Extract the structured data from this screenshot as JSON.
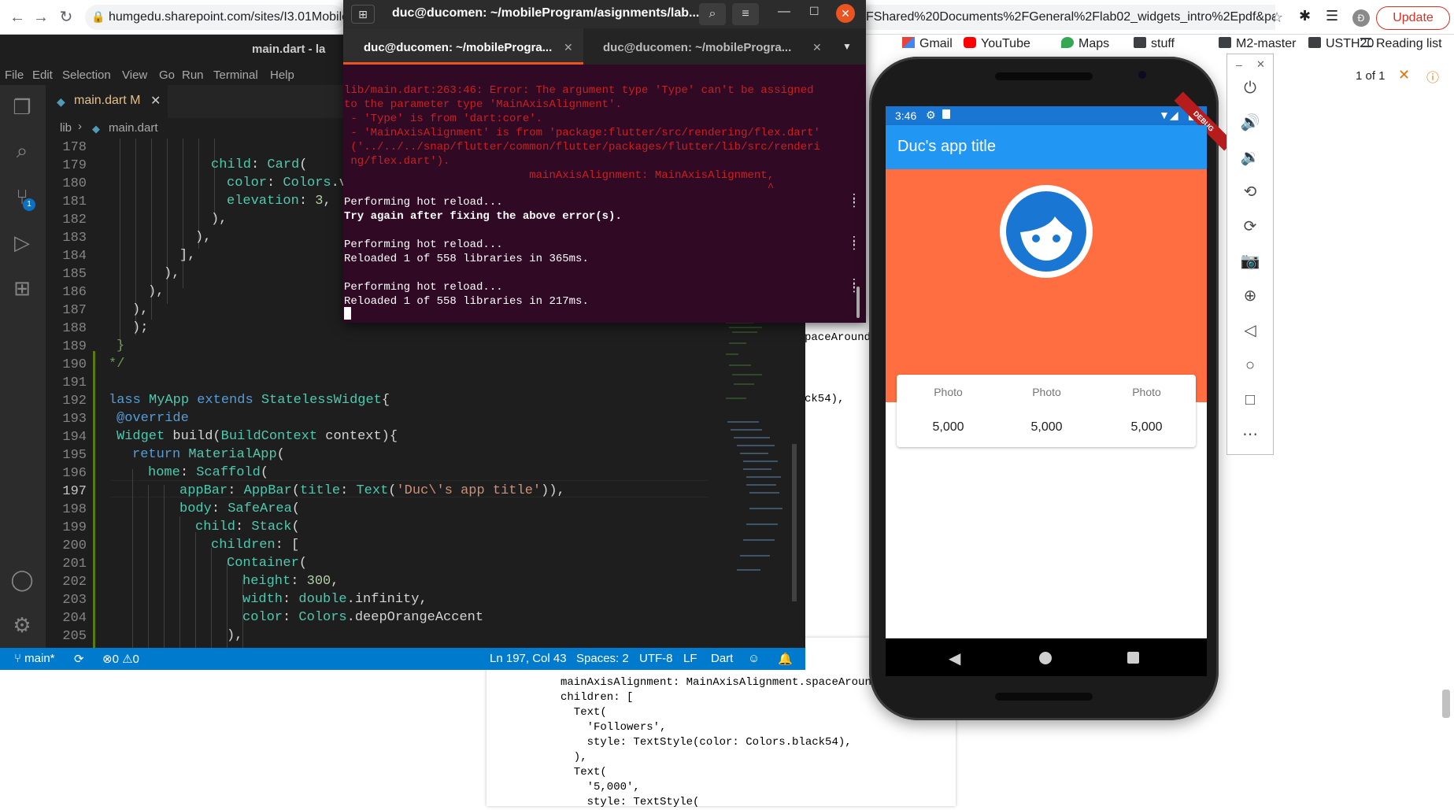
{
  "browser": {
    "url_left": "humgedu.sharepoint.com/sites/I3.01Mobilepro",
    "url_right": "FShared%20Documents%2FGeneral%2Flab02_widgets_intro%2Epdf&parent...",
    "avatar_letter": "Đ",
    "update_label": "Update",
    "bookmarks": [
      "Gmail",
      "YouTube",
      "Maps",
      "stuff",
      "M2-master",
      "USTH20"
    ],
    "reading_list": "Reading list",
    "pdf_pages": "1 of 1"
  },
  "pdf": {
    "right_snippets": [
      "paceAround",
      "ck54),"
    ],
    "code_lines": [
      "mainAxisAlignment: MainAxisAlignment.spaceAround,",
      "children: [",
      "  Text(",
      "    'Followers',",
      "    style: TextStyle(color: Colors.black54),",
      "  ),",
      "  Text(",
      "    '5,000',",
      "    style: TextStyle("
    ]
  },
  "vscode": {
    "window_title": "main.dart - la",
    "menus": [
      "File",
      "Edit",
      "Selection",
      "View",
      "Go",
      "Run",
      "Terminal",
      "Help"
    ],
    "tab_label": "main.dart",
    "tab_status": "M",
    "breadcrumb_folder": "lib",
    "breadcrumb_file": "main.dart",
    "scm_badge": "1",
    "line_numbers": [
      "178",
      "179",
      "180",
      "181",
      "182",
      "183",
      "184",
      "185",
      "186",
      "187",
      "188",
      "189",
      "190",
      "191",
      "192",
      "193",
      "194",
      "195",
      "196",
      "197",
      "198",
      "199",
      "200",
      "201",
      "202",
      "203",
      "204",
      "205"
    ],
    "status": {
      "branch": "main*",
      "problems": "0",
      "warnings": "0",
      "position": "Ln 197, Col 43",
      "spaces": "Spaces: 2",
      "encoding": "UTF-8",
      "eol": "LF",
      "language": "Dart"
    }
  },
  "terminal": {
    "title": "duc@ducomen: ~/mobileProgram/asignments/lab...",
    "tab1": "duc@ducomen: ~/mobileProgra...",
    "tab2": "duc@ducomen: ~/mobileProgra...",
    "error_lines": [
      "lib/main.dart:263:46: Error: The argument type 'Type' can't be assigned",
      "to the parameter type 'MainAxisAlignment'.",
      " - 'Type' is from 'dart:core'.",
      " - 'MainAxisAlignment' is from 'package:flutter/src/rendering/flex.dart'",
      " ('../../../snap/flutter/common/flutter/packages/flutter/lib/src/renderi",
      " ng/flex.dart').",
      "                            mainAxisAlignment: MainAxisAlignment,",
      "                                                                ^"
    ],
    "log": {
      "hot1": "Performing hot reload...",
      "try_again": "Try again after fixing the above error(s).",
      "hot2": "Performing hot reload...",
      "reload2": "Reloaded 1 of 558 libraries in 365ms.",
      "hot3": "Performing hot reload...",
      "reload3": "Reloaded 1 of 558 libraries in 217ms."
    }
  },
  "phone": {
    "time": "3:46",
    "debug": "DEBUG",
    "app_title": "Duc's app title",
    "stats": [
      {
        "label": "Photo",
        "value": "5,000"
      },
      {
        "label": "Photo",
        "value": "5,000"
      },
      {
        "label": "Photo",
        "value": "5,000"
      }
    ],
    "colors": {
      "app_bar": "#2196f3",
      "header_bg": "#ff6e40",
      "avatar": "#1976d2"
    }
  },
  "emulator_toolbar": [
    "power-icon",
    "volume-up-icon",
    "volume-down-icon",
    "rotate-left-icon",
    "rotate-right-icon",
    "camera-icon",
    "zoom-icon",
    "back-icon",
    "home-icon",
    "overview-icon",
    "more-icon"
  ]
}
